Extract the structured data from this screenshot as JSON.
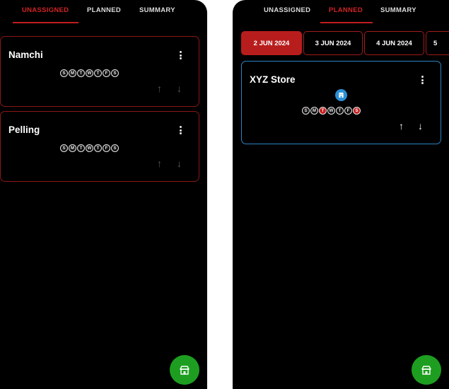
{
  "left_screen": {
    "tabs": [
      {
        "label": "UNASSIGNED",
        "active": true
      },
      {
        "label": "PLANNED",
        "active": false
      },
      {
        "label": "SUMMARY",
        "active": false
      }
    ],
    "cards": [
      {
        "title": "Namchi",
        "days": [
          "S",
          "M",
          "T",
          "W",
          "T",
          "F",
          "S"
        ]
      },
      {
        "title": "Pelling",
        "days": [
          "S",
          "M",
          "T",
          "W",
          "T",
          "F",
          "S"
        ]
      }
    ],
    "fab_icon": "store-assign-icon"
  },
  "right_screen": {
    "tabs": [
      {
        "label": "UNASSIGNED",
        "active": false
      },
      {
        "label": "PLANNED",
        "active": true
      },
      {
        "label": "SUMMARY",
        "active": false
      }
    ],
    "date_tabs": [
      {
        "label": "2 JUN 2024",
        "active": true
      },
      {
        "label": "3 JUN 2024",
        "active": false
      },
      {
        "label": "4 JUN 2024",
        "active": false
      },
      {
        "label": "5",
        "active": false
      }
    ],
    "card": {
      "title": "XYZ Store",
      "badge_icon": "store-icon",
      "days": [
        "S",
        "M",
        "T",
        "W",
        "T",
        "F",
        "S"
      ],
      "highlighted_days": [
        2,
        6
      ]
    },
    "fab_icon": "store-assign-icon"
  },
  "colors": {
    "accent_red": "#c21d1d",
    "card_blue_border": "#2b84c3",
    "fab_green": "#1e9e20",
    "background": "#000000"
  }
}
